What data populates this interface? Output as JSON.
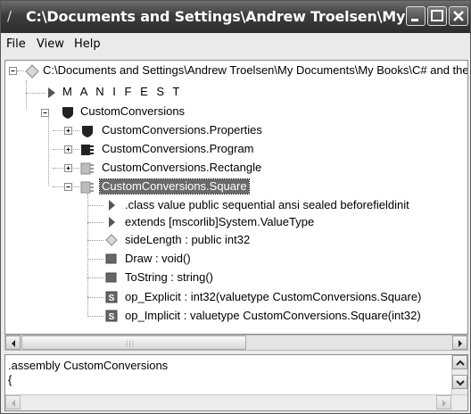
{
  "window": {
    "title": "C:\\Documents and Settings\\Andrew Troelsen\\My ...",
    "app_icon": "pen-icon"
  },
  "menu": {
    "items": [
      "File",
      "View",
      "Help"
    ]
  },
  "tree": {
    "root_label": "C:\\Documents and Settings\\Andrew Troelsen\\My Documents\\My Books\\C# and the .NET Platform",
    "manifest_label": "M A N I F E S T",
    "namespace_label": "CustomConversions",
    "types": [
      {
        "label": "CustomConversions.Properties",
        "icon": "namespace-icon"
      },
      {
        "label": "CustomConversions.Program",
        "icon": "class-icon"
      },
      {
        "label": "CustomConversions.Rectangle",
        "icon": "valuetype-icon"
      },
      {
        "label": "CustomConversions.Square",
        "icon": "valuetype-icon",
        "selected": true
      }
    ],
    "members": [
      {
        "label": ".class value public sequential ansi sealed beforefieldinit",
        "icon": "triangle-icon"
      },
      {
        "label": "extends [mscorlib]System.ValueType",
        "icon": "triangle-icon"
      },
      {
        "label": "sideLength : public int32",
        "icon": "field-icon"
      },
      {
        "label": "Draw : void()",
        "icon": "method-icon"
      },
      {
        "label": "ToString : string()",
        "icon": "method-icon"
      },
      {
        "label": "op_Explicit : int32(valuetype CustomConversions.Square)",
        "icon": "static-method-icon"
      },
      {
        "label": "op_Implicit : valuetype CustomConversions.Square(int32)",
        "icon": "static-method-icon"
      }
    ]
  },
  "il_pane": {
    "line1": ".assembly CustomConversions",
    "line2": "{"
  }
}
